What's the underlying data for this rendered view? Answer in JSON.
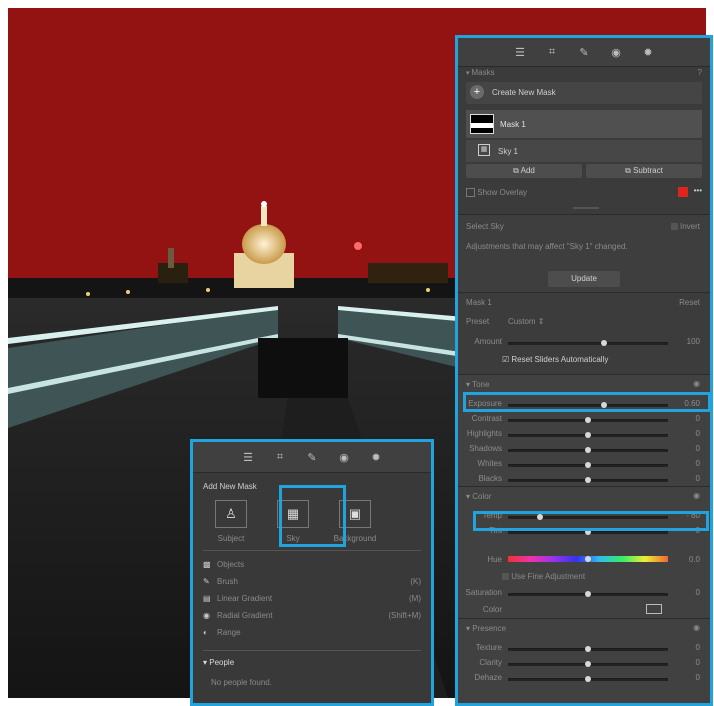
{
  "toolbar_icons": [
    "sliders-icon",
    "crop-icon",
    "brush-icon",
    "red-eye-icon",
    "masking-icon"
  ],
  "masks": {
    "header": "Masks",
    "create_new_mask": "Create New Mask",
    "mask_name": "Mask 1",
    "component_name": "Sky 1",
    "add_label": "Add",
    "subtract_label": "Subtract",
    "show_overlay": "Show Overlay",
    "overlay_color": "#e0241b"
  },
  "select_sky": {
    "title": "Select Sky",
    "invert": "Invert",
    "message": "Adjustments that may affect \"Sky 1\" changed.",
    "update": "Update"
  },
  "mask_settings": {
    "title": "Mask 1",
    "reset": "Reset",
    "preset_label": "Preset",
    "preset_value": "Custom",
    "amount_label": "Amount",
    "amount_value": "100",
    "amount_fraction": 0.6,
    "reset_sliders": "Reset Sliders Automatically"
  },
  "tone": {
    "title": "Tone",
    "sliders": [
      {
        "label": "Exposure",
        "value": "0.60",
        "pos": 0.6
      },
      {
        "label": "Contrast",
        "value": "0",
        "pos": 0.5
      },
      {
        "label": "Highlights",
        "value": "0",
        "pos": 0.5
      },
      {
        "label": "Shadows",
        "value": "0",
        "pos": 0.5
      },
      {
        "label": "Whites",
        "value": "0",
        "pos": 0.5
      },
      {
        "label": "Blacks",
        "value": "0",
        "pos": 0.5
      }
    ]
  },
  "color": {
    "title": "Color",
    "sliders": [
      {
        "label": "Temp",
        "value": "- 60",
        "pos": 0.2
      },
      {
        "label": "Tint",
        "value": "0",
        "pos": 0.5
      }
    ],
    "hue_label": "Hue",
    "hue_value": "0.0",
    "fine_adjust": "Use Fine Adjustment",
    "saturation_label": "Saturation",
    "saturation_value": "0",
    "color_label": "Color"
  },
  "presence": {
    "title": "Presence",
    "sliders": [
      {
        "label": "Texture",
        "value": "0",
        "pos": 0.5
      },
      {
        "label": "Clarity",
        "value": "0",
        "pos": 0.5
      },
      {
        "label": "Dehaze",
        "value": "0",
        "pos": 0.5
      }
    ]
  },
  "popup": {
    "title": "Add New Mask",
    "types": [
      {
        "label": "Subject",
        "icon": "subject-icon"
      },
      {
        "label": "Sky",
        "icon": "sky-icon"
      },
      {
        "label": "Background",
        "icon": "background-icon"
      }
    ],
    "tools": [
      {
        "label": "Objects",
        "shortcut": "",
        "icon": "objects-icon"
      },
      {
        "label": "Brush",
        "shortcut": "(K)",
        "icon": "brush-icon"
      },
      {
        "label": "Linear Gradient",
        "shortcut": "(M)",
        "icon": "linear-gradient-icon"
      },
      {
        "label": "Radial Gradient",
        "shortcut": "(Shift+M)",
        "icon": "radial-gradient-icon"
      },
      {
        "label": "Range",
        "shortcut": "",
        "icon": "range-icon"
      }
    ],
    "people_title": "People",
    "people_message": "No people found."
  }
}
